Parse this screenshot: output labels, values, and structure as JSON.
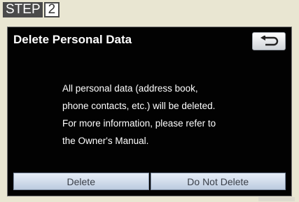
{
  "step": {
    "label": "STEP",
    "number": "2"
  },
  "dialog": {
    "title": "Delete Personal Data",
    "back_icon": "return-arrow-icon",
    "message_lines": [
      "All personal data (address book,",
      "phone contacts, etc.) will be deleted.",
      "For more information, please refer to",
      "the Owner's Manual."
    ],
    "delete_label": "Delete",
    "do_not_delete_label": "Do Not Delete"
  },
  "colors": {
    "screen_bg": "#020202",
    "button_blue": "#bccbdf",
    "page_bg": "#e9e6d2"
  }
}
